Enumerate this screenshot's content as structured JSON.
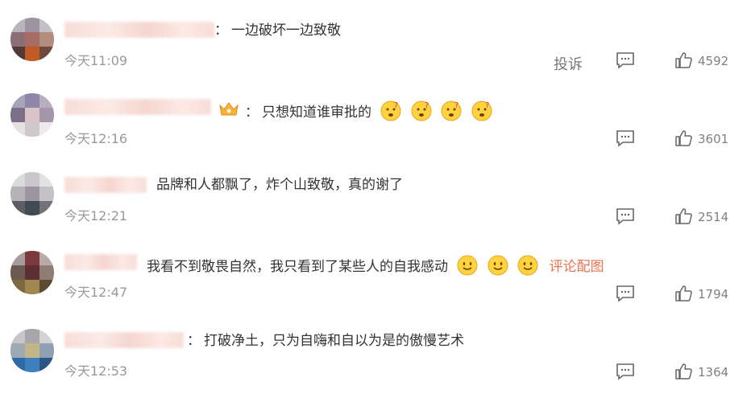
{
  "comments": [
    {
      "text": "一边破坏一边致敬",
      "colon": "：",
      "time": "今天11:09",
      "likes": "4592",
      "report": "投诉",
      "emojis": [],
      "link": ""
    },
    {
      "text": "只想知道谁审批的",
      "colon": "：",
      "time": "今天12:16",
      "likes": "3601",
      "report": "",
      "emojis": [
        "thinking",
        "thinking",
        "thinking",
        "thinking"
      ],
      "link": ""
    },
    {
      "text": "品牌和人都飘了，炸个山致敬，真的谢了",
      "colon": "",
      "time": "今天12:21",
      "likes": "2514",
      "report": "",
      "emojis": [],
      "link": ""
    },
    {
      "text": "我看不到敬畏自然，我只看到了某些人的自我感动",
      "colon": "",
      "time": "今天12:47",
      "likes": "1794",
      "report": "",
      "emojis": [
        "smile",
        "smile",
        "smile"
      ],
      "link": "评论配图"
    },
    {
      "text": "打破净土，只为自嗨和自以为是的傲慢艺术",
      "colon": "：",
      "time": "今天12:53",
      "likes": "1364",
      "report": "",
      "emojis": [],
      "link": ""
    }
  ],
  "icons": {
    "comment": "comment-bubble-icon",
    "like": "thumbs-up-icon"
  },
  "colors": {
    "link": "#eb7350",
    "time": "#999999",
    "text": "#333333",
    "count": "#808080"
  }
}
